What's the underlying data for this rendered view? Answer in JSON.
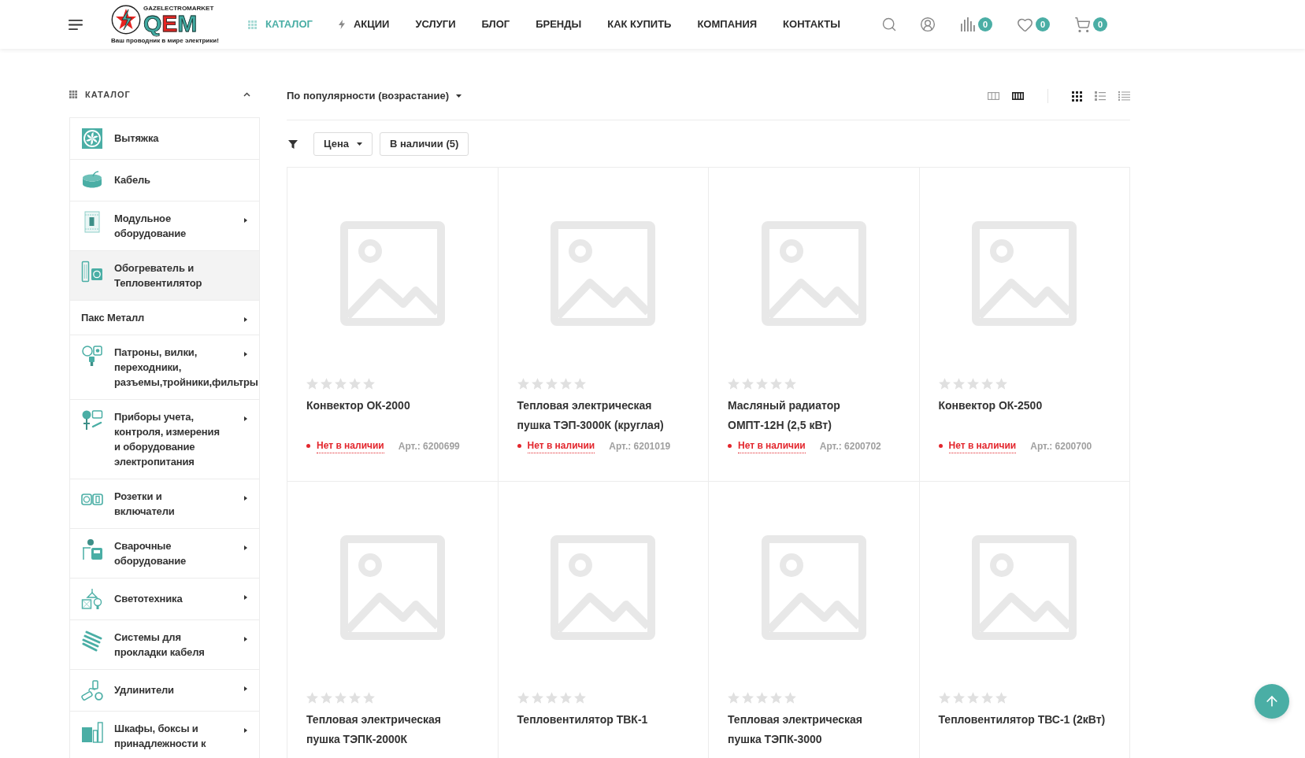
{
  "header": {
    "logo": {
      "top_text": "GAZELECTROMARKET",
      "mark": "QEM",
      "tagline": "Ваш проводник в мире электрики!"
    },
    "nav": [
      {
        "label": "КАТАЛОГ",
        "kind": "catalog",
        "selected": true
      },
      {
        "label": "АКЦИИ",
        "kind": "promo",
        "selected": false
      },
      {
        "label": "УСЛУГИ",
        "kind": "link",
        "selected": false
      },
      {
        "label": "БЛОГ",
        "kind": "link",
        "selected": false
      },
      {
        "label": "БРЕНДЫ",
        "kind": "link",
        "selected": false
      },
      {
        "label": "КАК КУПИТЬ",
        "kind": "link",
        "selected": false
      },
      {
        "label": "КОМПАНИЯ",
        "kind": "link",
        "selected": false
      },
      {
        "label": "КОНТАКТЫ",
        "kind": "link",
        "selected": false
      }
    ],
    "counters": [
      {
        "kind": "compare",
        "count": "0"
      },
      {
        "kind": "favorites",
        "count": "0"
      },
      {
        "kind": "cart",
        "count": "0"
      }
    ]
  },
  "sidebar": {
    "title": "КАТАЛОГ",
    "expanded": true,
    "items": [
      {
        "label": "Вытяжка",
        "selected": false,
        "has_submenu": false
      },
      {
        "label": "Кабель",
        "selected": false,
        "has_submenu": false
      },
      {
        "label": "Модульное\nоборудование",
        "selected": false,
        "has_submenu": true
      },
      {
        "label": "Обогреватель и\nТепловентилятор",
        "selected": true,
        "has_submenu": false
      },
      {
        "label": "Пакс Металл",
        "selected": false,
        "has_submenu": true
      },
      {
        "label": "Патроны, вилки,\nпереходники,\nразъемы,тройники,фильтры",
        "selected": false,
        "has_submenu": true
      },
      {
        "label": "Приборы учета,\nконтроля, измерения\nи оборудование\nэлектропитания",
        "selected": false,
        "has_submenu": true
      },
      {
        "label": "Розетки и\nвключатели",
        "selected": false,
        "has_submenu": true
      },
      {
        "label": "Сварочные\nоборудование",
        "selected": false,
        "has_submenu": true
      },
      {
        "label": "Светотехника",
        "selected": false,
        "has_submenu": true
      },
      {
        "label": "Системы для\nпрокладки кабеля",
        "selected": false,
        "has_submenu": true
      },
      {
        "label": "Удлинители",
        "selected": false,
        "has_submenu": true
      },
      {
        "label": "Шкафы, боксы и\nпринадлежности к",
        "selected": false,
        "has_submenu": true
      }
    ]
  },
  "toolbar": {
    "sort": "По популярности (возрастание)",
    "column_options": [
      {
        "kind": "three_columns",
        "selected": false
      },
      {
        "kind": "four_columns",
        "selected": true
      }
    ],
    "view_options": [
      {
        "kind": "grid",
        "selected": true
      },
      {
        "kind": "list",
        "selected": false
      },
      {
        "kind": "table",
        "selected": false
      }
    ]
  },
  "filters": [
    {
      "label": "Цена",
      "kind": "dropdown"
    },
    {
      "label": "В наличии (5)",
      "kind": "toggle"
    }
  ],
  "products": [
    {
      "name": "Конвектор ОК-2000",
      "stars": 0,
      "status": "Нет в наличии",
      "in_stock": false,
      "article": "Арт.: 6200699"
    },
    {
      "name": "Тепловая электрическая\nпушка ТЭП-3000К (круглая)",
      "stars": 0,
      "status": "Нет в наличии",
      "in_stock": false,
      "article": "Арт.: 6201019"
    },
    {
      "name": "Масляный радиатор\nОМПТ-12Н (2,5 кВт)",
      "stars": 0,
      "status": "Нет в наличии",
      "in_stock": false,
      "article": "Арт.: 6200702"
    },
    {
      "name": "Конвектор ОК-2500",
      "stars": 0,
      "status": "Нет в наличии",
      "in_stock": false,
      "article": "Арт.: 6200700"
    },
    {
      "name": "Тепловая электрическая\nпушка ТЭПК-2000К",
      "stars": 0
    },
    {
      "name": "Тепловентилятор ТВК-1",
      "stars": 0
    },
    {
      "name": "Тепловая электрическая\nпушка ТЭПК-3000",
      "stars": 0
    },
    {
      "name": "Тепловентилятор ТВС-1 (2кВт)",
      "stars": 0
    }
  ]
}
